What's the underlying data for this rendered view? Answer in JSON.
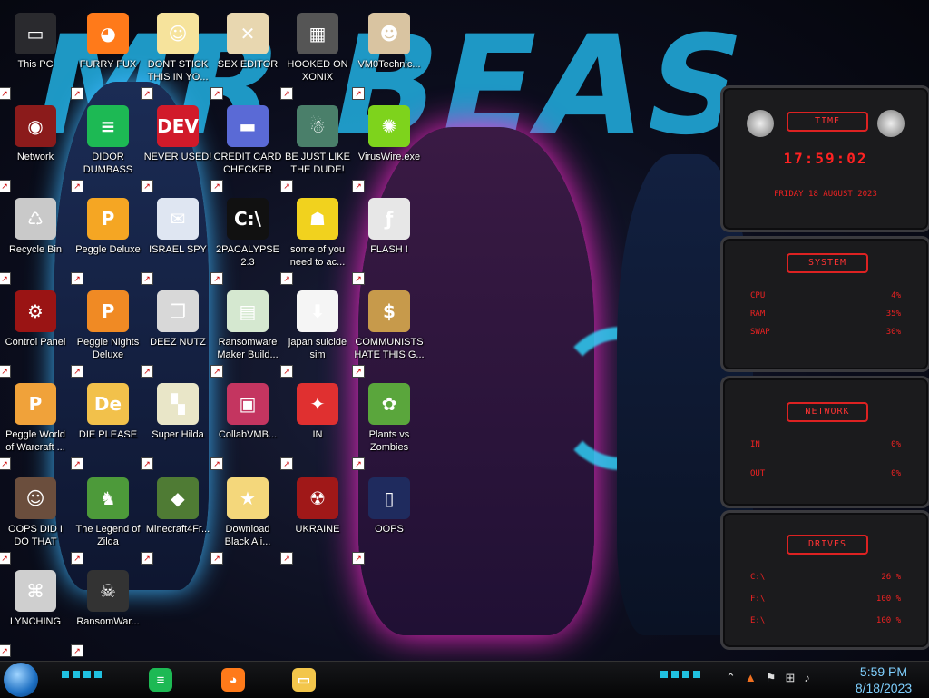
{
  "wallpaper": {
    "title": "MR BEAST"
  },
  "icons": [
    {
      "label": "This PC",
      "color": "#2a2a2e",
      "glyph": "▭"
    },
    {
      "label": "FURRY FUX",
      "color": "#ff7a1a",
      "glyph": "◕"
    },
    {
      "label": "DONT STICK THIS IN YO...",
      "color": "#f6e39c",
      "glyph": "☺"
    },
    {
      "label": "SEX EDITOR",
      "color": "#e8d7b0",
      "glyph": "✕"
    },
    {
      "label": "HOOKED ON XONIX",
      "color": "#555",
      "glyph": "▦"
    },
    {
      "label": "VM0Technic...",
      "color": "#d9c4a1",
      "glyph": "☻"
    },
    {
      "label": "Network",
      "color": "#8b1b1b",
      "glyph": "◉"
    },
    {
      "label": "DIDOR DUMBASS",
      "color": "#1db954",
      "glyph": "≡"
    },
    {
      "label": "NEVER USED!",
      "color": "#d11a2a",
      "glyph": "DEV"
    },
    {
      "label": "CREDIT CARD CHECKER",
      "color": "#5a6ad6",
      "glyph": "▬"
    },
    {
      "label": "BE JUST LIKE THE DUDE!",
      "color": "#4a7f6a",
      "glyph": "☃"
    },
    {
      "label": "VirusWire.exe",
      "color": "#7ed31c",
      "glyph": "✺"
    },
    {
      "label": "Recycle Bin",
      "color": "#c9c9c9",
      "glyph": "♺"
    },
    {
      "label": "Peggle Deluxe",
      "color": "#f5a623",
      "glyph": "P"
    },
    {
      "label": "ISRAEL SPY",
      "color": "#dfe6f2",
      "glyph": "✉"
    },
    {
      "label": "2PACALYPSE 2.3",
      "color": "#111",
      "glyph": "C:\\"
    },
    {
      "label": "some of you need to ac...",
      "color": "#f1d21e",
      "glyph": "☗"
    },
    {
      "label": "FLASH !",
      "color": "#e7e7e7",
      "glyph": "ƒ"
    },
    {
      "label": "Control Panel",
      "color": "#9a1414",
      "glyph": "⚙"
    },
    {
      "label": "Peggle Nights Deluxe",
      "color": "#f08a24",
      "glyph": "P"
    },
    {
      "label": "DEEZ NUTZ",
      "color": "#d8d8d8",
      "glyph": "❐"
    },
    {
      "label": "Ransomware Maker Build...",
      "color": "#d5e8d0",
      "glyph": "▤"
    },
    {
      "label": "japan suicide sim",
      "color": "#f5f5f5",
      "glyph": "⬇"
    },
    {
      "label": "COMMUNISTS HATE THIS G...",
      "color": "#c79a4b",
      "glyph": "$"
    },
    {
      "label": "Peggle World of Warcraft ...",
      "color": "#f0a23a",
      "glyph": "P"
    },
    {
      "label": "DIE PLEASE",
      "color": "#f2c14b",
      "glyph": "De"
    },
    {
      "label": "Super Hilda",
      "color": "#e9e6c8",
      "glyph": "▚"
    },
    {
      "label": "CollabVMB...",
      "color": "#c43560",
      "glyph": "▣"
    },
    {
      "label": "IN",
      "color": "#e03030",
      "glyph": "✦"
    },
    {
      "label": "Plants vs Zombies",
      "color": "#5aa63c",
      "glyph": "✿"
    },
    {
      "label": "OOPS DID I DO THAT",
      "color": "#6b4e3d",
      "glyph": "☺"
    },
    {
      "label": "The Legend of Zilda",
      "color": "#4d9a3a",
      "glyph": "♞"
    },
    {
      "label": "Minecraft4Fr...",
      "color": "#4f7b34",
      "glyph": "◆"
    },
    {
      "label": "Download Black Ali...",
      "color": "#f4d77b",
      "glyph": "★"
    },
    {
      "label": "UKRAINE",
      "color": "#a01818",
      "glyph": "☢"
    },
    {
      "label": "OOPS",
      "color": "#1f2b5e",
      "glyph": "▯"
    },
    {
      "label": "LYNCHING",
      "color": "#cfcfcf",
      "glyph": "⌘"
    },
    {
      "label": "RansomWar...",
      "color": "#333",
      "glyph": "☠"
    }
  ],
  "widgets": {
    "time": {
      "heading": "TIME",
      "clock": "17:59:02",
      "date": "FRIDAY 18 AUGUST 2023"
    },
    "system": {
      "heading": "SYSTEM",
      "rows": [
        {
          "name": "CPU",
          "value": "4%"
        },
        {
          "name": "RAM",
          "value": "35%"
        },
        {
          "name": "SWAP",
          "value": "30%"
        }
      ]
    },
    "network": {
      "heading": "NETWORK",
      "rows": [
        {
          "name": "IN",
          "value": "0%"
        },
        {
          "name": "OUT",
          "value": "0%"
        }
      ]
    },
    "drives": {
      "heading": "DRIVES",
      "rows": [
        {
          "name": "C:\\",
          "value": "26 %"
        },
        {
          "name": "F:\\",
          "value": "100 %"
        },
        {
          "name": "E:\\",
          "value": "100 %"
        }
      ]
    }
  },
  "taskbar": {
    "start": "start-orb",
    "pinned": [
      {
        "name": "app-green-icon",
        "color": "#1db954",
        "glyph": "≡"
      },
      {
        "name": "firefox-icon",
        "color": "#ff7a1a",
        "glyph": "◕"
      },
      {
        "name": "file-explorer-icon",
        "color": "#f3c64b",
        "glyph": "▭"
      }
    ],
    "time": "5:59 PM",
    "date": "8/18/2023"
  }
}
